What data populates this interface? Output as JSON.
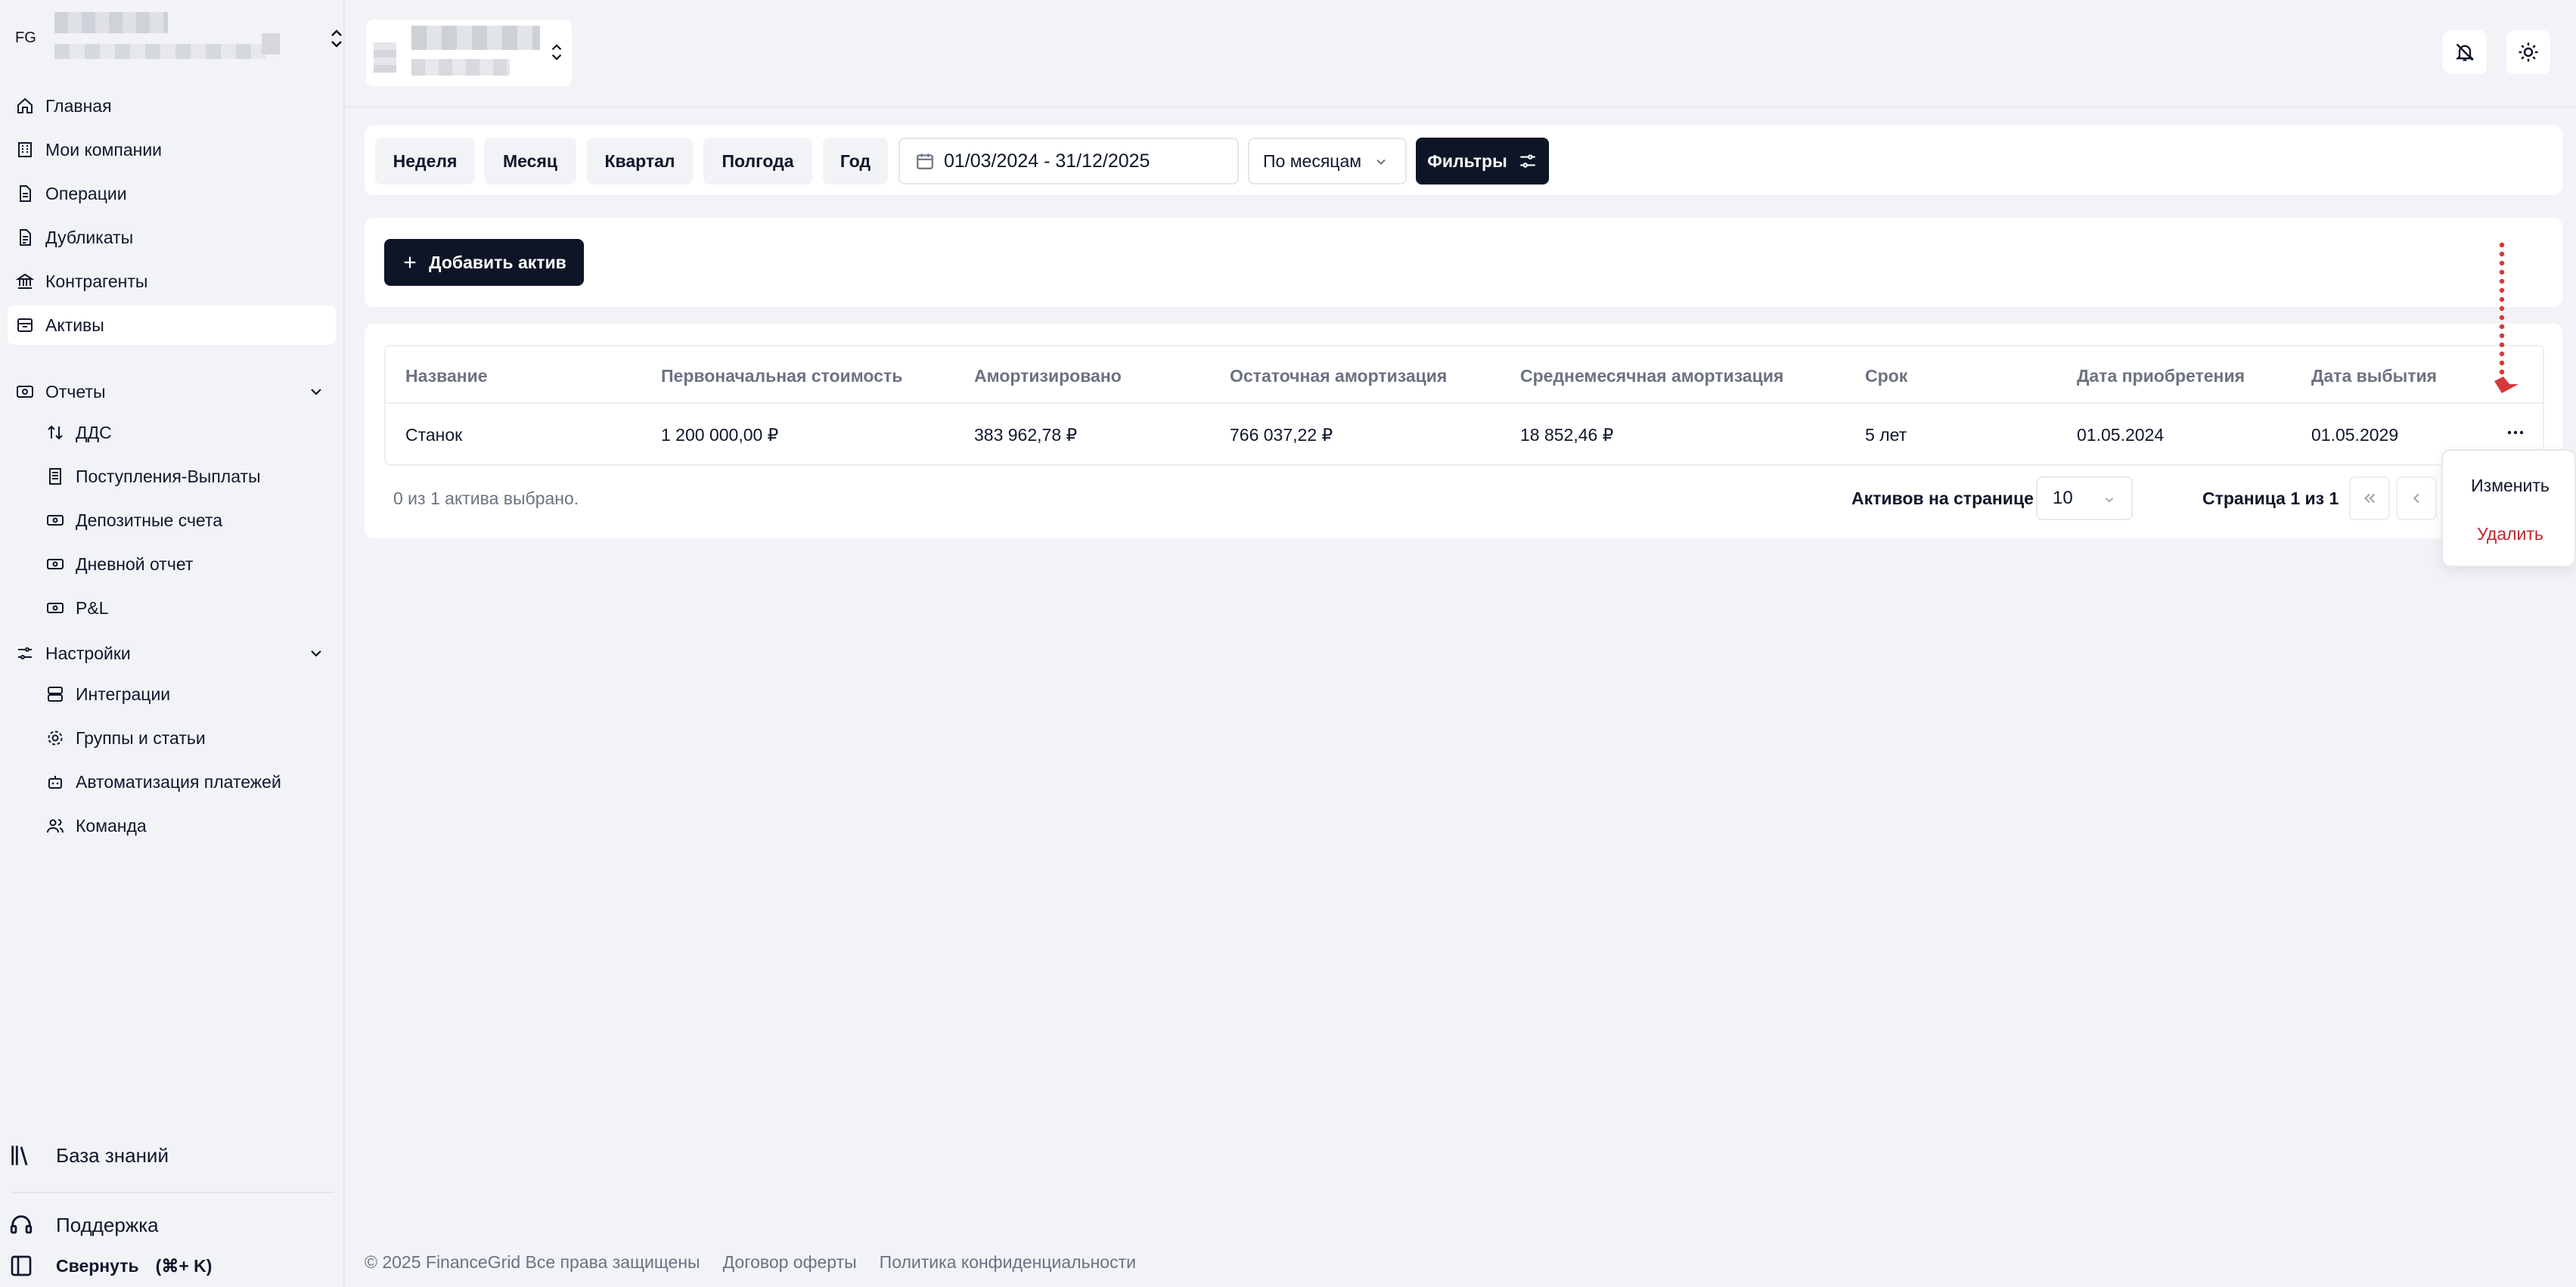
{
  "sidebar": {
    "org_initials": "FG",
    "nav": [
      {
        "label": "Главная",
        "icon": "home-icon"
      },
      {
        "label": "Мои компании",
        "icon": "building-icon"
      },
      {
        "label": "Операции",
        "icon": "document-icon"
      },
      {
        "label": "Дубликаты",
        "icon": "document-copy-icon"
      },
      {
        "label": "Контрагенты",
        "icon": "bank-icon"
      },
      {
        "label": "Активы",
        "icon": "archive-icon",
        "active": true
      }
    ],
    "reports": {
      "label": "Отчеты",
      "items": [
        "ДДС",
        "Поступления-Выплаты",
        "Депозитные счета",
        "Дневной отчет",
        "P&L"
      ]
    },
    "settings": {
      "label": "Настройки",
      "items": [
        "Интеграции",
        "Группы и статьи",
        "Автоматизация платежей",
        "Команда"
      ]
    },
    "knowledge_base": "База знаний",
    "support": "Поддержка",
    "collapse": "Свернуть",
    "collapse_shortcut": "(⌘+ K)"
  },
  "toolbar": {
    "periods": [
      "Неделя",
      "Месяц",
      "Квартал",
      "Полгода",
      "Год"
    ],
    "date_range": "01/03/2024 - 31/12/2025",
    "grouping": "По месяцам",
    "filters_label": "Фильтры"
  },
  "actions": {
    "add_asset": "Добавить актив"
  },
  "table": {
    "columns": [
      "Название",
      "Первоначальная стоимость",
      "Амортизировано",
      "Остаточная амортизация",
      "Среднемесячная амортизация",
      "Срок",
      "Дата приобретения",
      "Дата выбытия"
    ],
    "rows": [
      [
        "Станок",
        "1 200 000,00 ₽",
        "383 962,78 ₽",
        "766 037,22 ₽",
        "18 852,46 ₽",
        "5 лет",
        "01.05.2024",
        "01.05.2029"
      ]
    ],
    "row_actions_label": "⋯"
  },
  "pagination": {
    "selected_text": "0 из 1 актива выбрано.",
    "per_page_label": "Активов на странице",
    "per_page_value": "10",
    "page_text": "Страница 1 из 1"
  },
  "row_menu": {
    "edit": "Изменить",
    "delete": "Удалить",
    "delete_color": "#c0262d"
  },
  "footer": {
    "copyright": "© 2025 FinanceGrid Все права защищены",
    "offer": "Договор оферты",
    "privacy": "Политика конфиденциальности"
  },
  "colors": {
    "primary_dark": "#0d1526",
    "background": "#f1f3f7",
    "annotation_red": "#d6393a"
  }
}
